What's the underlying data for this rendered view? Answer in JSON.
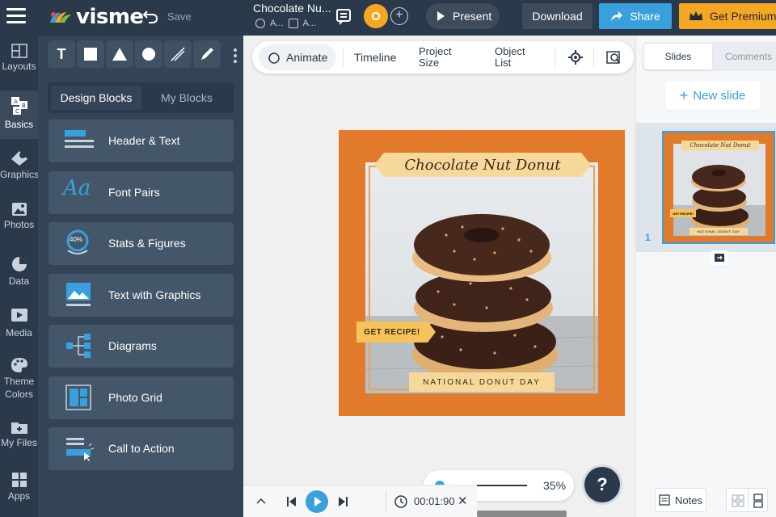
{
  "header": {
    "logo": "visme",
    "save_label": "Save",
    "doc_title": "Chocolate Nu...",
    "meta_a": "A...",
    "meta_b": "A...",
    "avatar_initial": "O",
    "present_label": "Present",
    "download_label": "Download",
    "share_label": "Share",
    "premium_label": "Get Premium"
  },
  "rail": [
    {
      "label": "Layouts",
      "icon": "layouts-icon"
    },
    {
      "label": "Basics",
      "icon": "basics-icon"
    },
    {
      "label": "Graphics",
      "icon": "graphics-icon"
    },
    {
      "label": "Photos",
      "icon": "photos-icon"
    },
    {
      "label": "Data",
      "icon": "data-icon"
    },
    {
      "label": "Media",
      "icon": "media-icon"
    },
    {
      "label": "Theme",
      "label2": "Colors",
      "icon": "palette-icon"
    },
    {
      "label": "My Files",
      "icon": "my-files-icon"
    },
    {
      "label": "Apps",
      "icon": "apps-icon"
    }
  ],
  "panel": {
    "tools": [
      "T"
    ],
    "tabs": {
      "design": "Design Blocks",
      "mine": "My Blocks"
    },
    "blocks": [
      {
        "label": "Header & Text",
        "icon": "header-text-icon"
      },
      {
        "label": "Font Pairs",
        "icon": "font-pairs-icon",
        "glyph": "Aa"
      },
      {
        "label": "Stats & Figures",
        "icon": "stats-icon",
        "glyph": "40%"
      },
      {
        "label": "Text with Graphics",
        "icon": "text-graphics-icon"
      },
      {
        "label": "Diagrams",
        "icon": "diagrams-icon"
      },
      {
        "label": "Photo Grid",
        "icon": "photo-grid-icon"
      },
      {
        "label": "Call to Action",
        "icon": "call-to-action-icon"
      }
    ]
  },
  "toolbar": {
    "animate": "Animate",
    "timeline": "Timeline",
    "project_size_1": "Project",
    "project_size_2": "Size",
    "object_list_1": "Object",
    "object_list_2": "List"
  },
  "slide": {
    "title": "Chocolate Nut Donut",
    "tag": "GET RECIPE!",
    "footer": "NATIONAL DONUT DAY"
  },
  "zoom": {
    "value": "35%",
    "level": 0.35
  },
  "player": {
    "time": "00:01:90"
  },
  "right": {
    "tab_slides": "Slides",
    "tab_comments": "Comments",
    "new_slide": "New slide",
    "slide_number": "1",
    "notes": "Notes"
  },
  "colors": {
    "dark": "#2b3a4a",
    "accent": "#3aa0dd",
    "premium": "#f5a623",
    "slide_bg": "#e17a2a"
  }
}
